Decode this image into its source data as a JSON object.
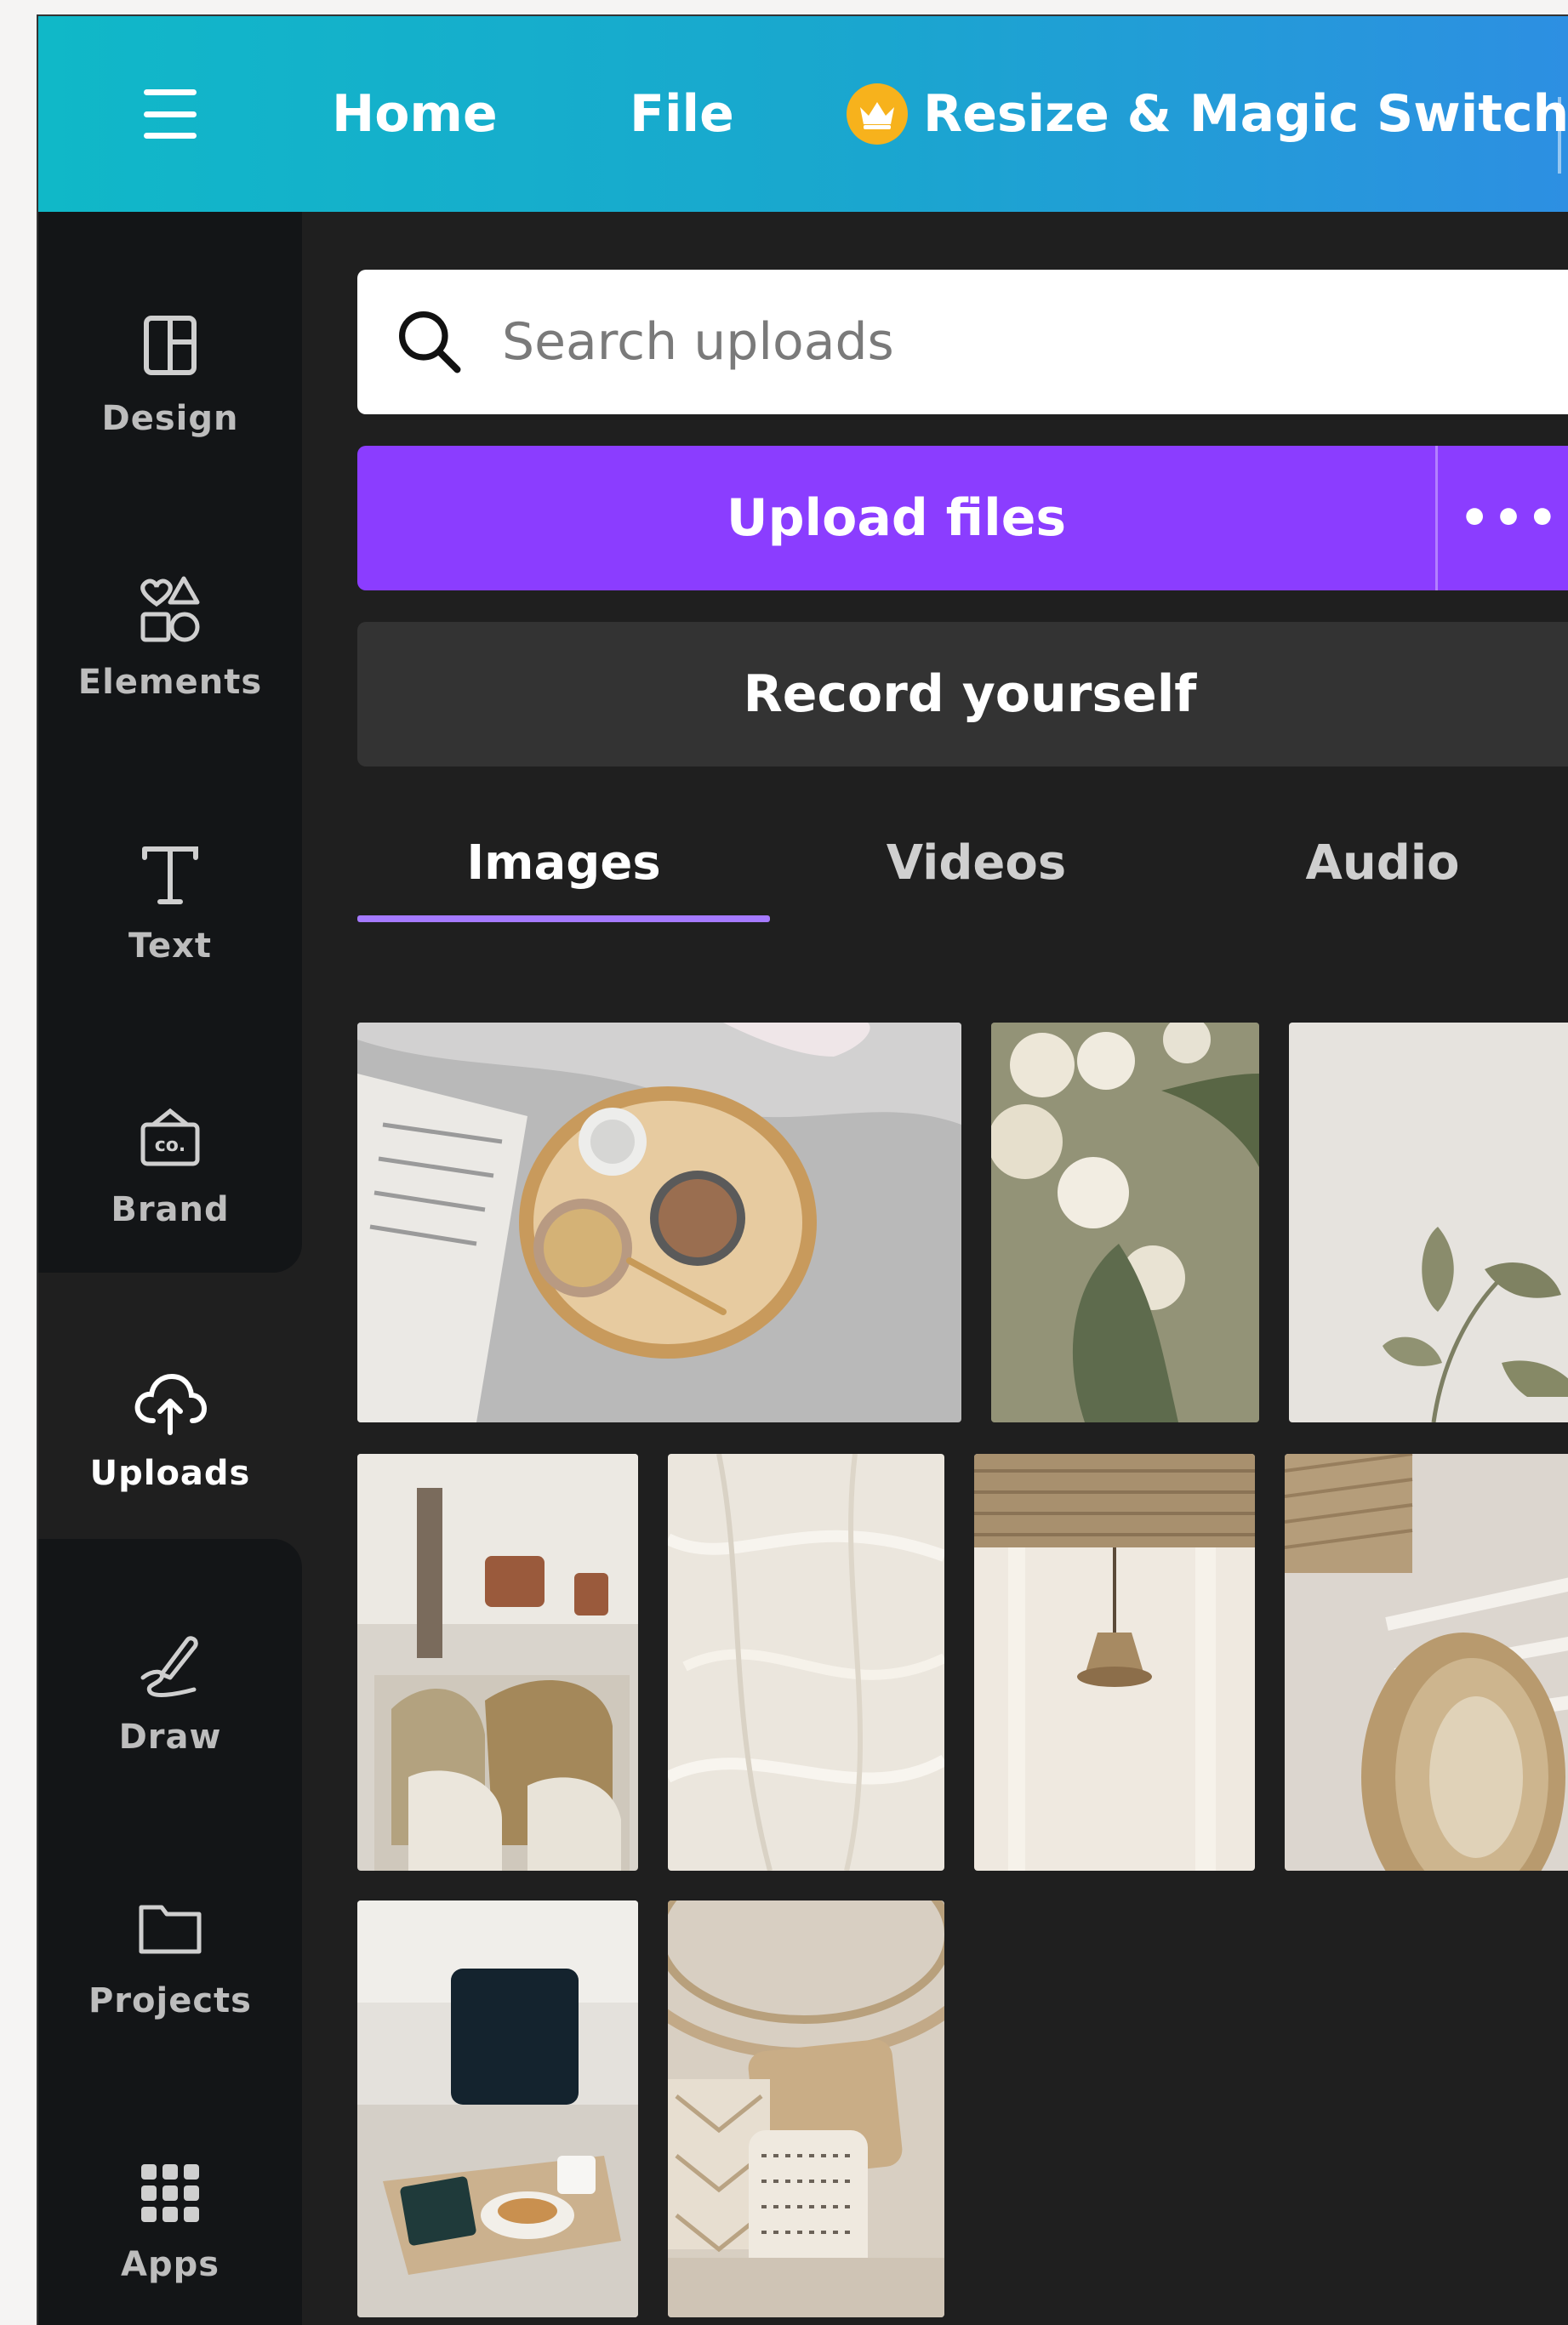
{
  "topbar": {
    "menu_icon": "hamburger-icon",
    "home_label": "Home",
    "file_label": "File",
    "resize_label": "Resize & Magic Switch",
    "resize_icon": "crown-icon"
  },
  "sidebar": {
    "items": [
      {
        "label": "Design",
        "icon": "layout-icon"
      },
      {
        "label": "Elements",
        "icon": "shapes-icon"
      },
      {
        "label": "Text",
        "icon": "text-icon"
      },
      {
        "label": "Brand",
        "icon": "brand-icon"
      },
      {
        "label": "Uploads",
        "icon": "cloud-upload-icon",
        "active": true
      },
      {
        "label": "Draw",
        "icon": "pen-icon"
      },
      {
        "label": "Projects",
        "icon": "folder-icon"
      },
      {
        "label": "Apps",
        "icon": "grid-icon"
      }
    ]
  },
  "search": {
    "placeholder": "Search uploads",
    "value": ""
  },
  "upload": {
    "button_label": "Upload files",
    "more_label": "•••"
  },
  "record": {
    "button_label": "Record yourself"
  },
  "tabs": [
    {
      "label": "Images",
      "active": true
    },
    {
      "label": "Videos",
      "active": false
    },
    {
      "label": "Audio",
      "active": false
    }
  ],
  "colors": {
    "accent_purple": "#8b3dff",
    "tab_indicator": "#a57aff",
    "topbar_start": "#10b8c8",
    "topbar_end": "#2d8fe2",
    "panel_bg": "#1f1f1f",
    "rail_bg": "#131517"
  }
}
